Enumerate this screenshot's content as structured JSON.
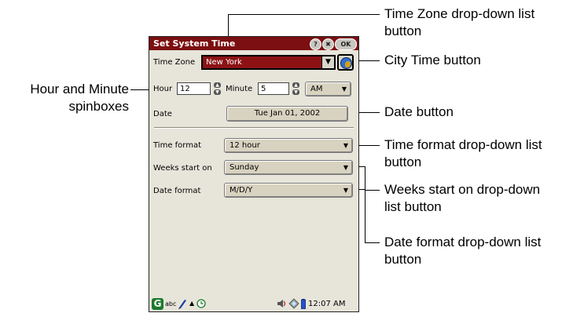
{
  "dialog": {
    "title": "Set System Time",
    "help_label": "?",
    "close_label": "✖",
    "ok_label": "OK",
    "time_zone": {
      "label": "Time Zone",
      "value": "New York",
      "arrow": "▼"
    },
    "hour": {
      "label": "Hour",
      "value": "12"
    },
    "minute": {
      "label": "Minute",
      "value": "5"
    },
    "ampm": {
      "value": "AM",
      "arrow": "▼"
    },
    "date": {
      "label": "Date",
      "value": "Tue Jan 01, 2002"
    },
    "time_format": {
      "label": "Time format",
      "value": "12 hour",
      "arrow": "▼"
    },
    "weeks_start": {
      "label": "Weeks start on",
      "value": "Sunday",
      "arrow": "▼"
    },
    "date_format": {
      "label": "Date format",
      "value": "M/D/Y",
      "arrow": "▼"
    }
  },
  "statusbar": {
    "g_badge": "G",
    "input_mode": "abc",
    "clock": "12:07 AM",
    "icons": [
      "pen-icon",
      "up-arrow-icon",
      "clock-icon",
      "speaker-icon",
      "sync-icon",
      "battery-icon"
    ]
  },
  "callouts": {
    "tz_line1": "Time Zone drop-down list",
    "tz_line2": "button",
    "city": "City Time button",
    "hm_line1": "Hour and Minute",
    "hm_line2": "spinboxes",
    "date": "Date button",
    "tf_line1": "Time format drop-down list",
    "tf_line2": "button",
    "ws_line1": "Weeks start on drop-down",
    "ws_line2": "list button",
    "df_line1": "Date format drop-down list",
    "df_line2": "button"
  },
  "colors": {
    "titlebar": "#7b0f11",
    "panel": "#e7e5da",
    "selected": "#8c1214"
  }
}
